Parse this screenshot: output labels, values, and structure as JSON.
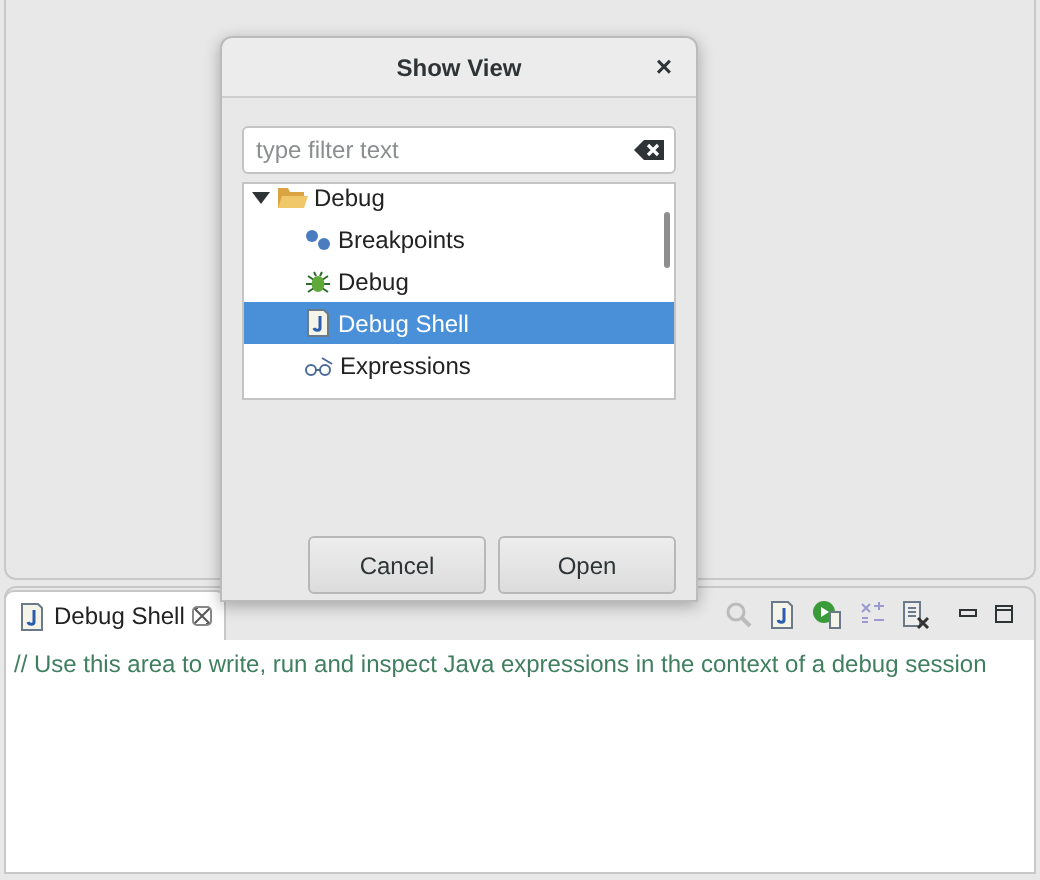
{
  "dialog": {
    "title": "Show View",
    "close": "×",
    "filter": {
      "placeholder": "type filter text"
    },
    "tree": [
      {
        "label": "Debug",
        "expanded": true,
        "children": [
          {
            "label": "Breakpoints",
            "selected": false
          },
          {
            "label": "Debug",
            "selected": false
          },
          {
            "label": "Debug Shell",
            "selected": true
          },
          {
            "label": "Expressions",
            "selected": false
          }
        ]
      }
    ],
    "buttons": [
      "Cancel",
      "Open"
    ]
  },
  "view": {
    "tabs": [
      {
        "label": "Debug Shell",
        "selected": true
      }
    ],
    "comment": "// Use this area to write, run and inspect Java expressions in the context of a debug session"
  }
}
